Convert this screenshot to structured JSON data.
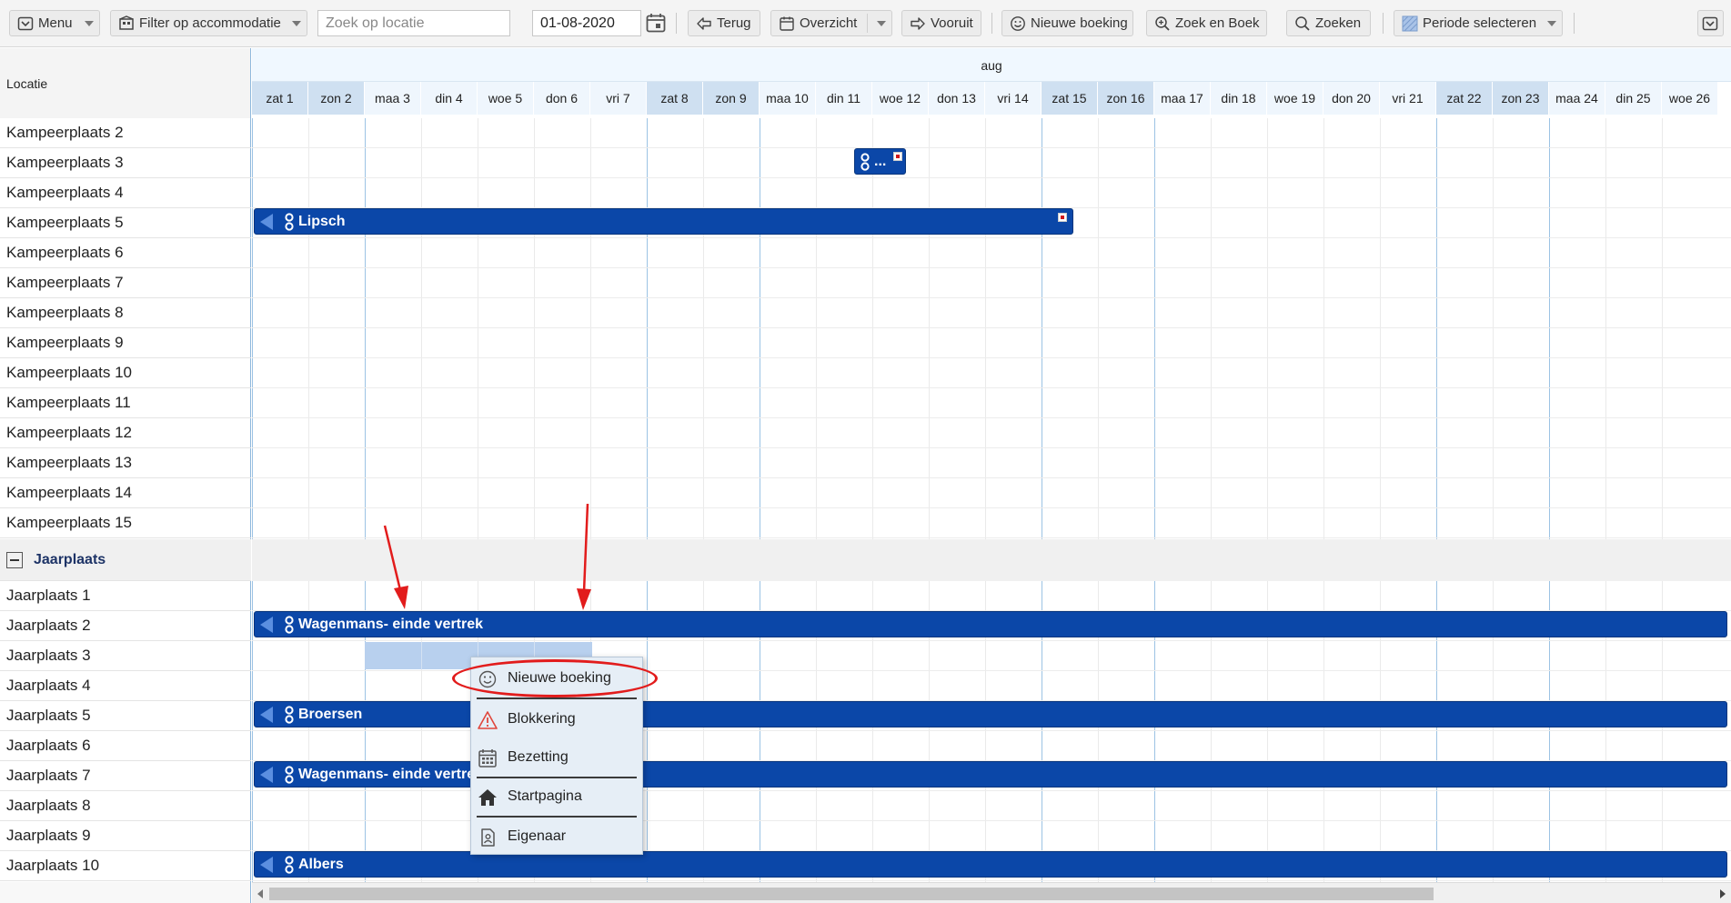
{
  "toolbar": {
    "menu_label": "Menu",
    "filter_label": "Filter op accommodatie",
    "search_placeholder": "Zoek op locatie",
    "date_value": "01-08-2020",
    "back_label": "Terug",
    "overview_label": "Overzicht",
    "forward_label": "Vooruit",
    "new_booking_label": "Nieuwe boeking",
    "search_book_label": "Zoek en Boek",
    "search_label": "Zoeken",
    "period_label": "Periode selecteren"
  },
  "left_header": "Locatie",
  "month": "aug",
  "days": [
    {
      "label": "zat 1",
      "weekend": true
    },
    {
      "label": "zon 2",
      "weekend": true
    },
    {
      "label": "maa 3",
      "weekend": false
    },
    {
      "label": "din 4",
      "weekend": false
    },
    {
      "label": "woe 5",
      "weekend": false
    },
    {
      "label": "don 6",
      "weekend": false
    },
    {
      "label": "vri 7",
      "weekend": false
    },
    {
      "label": "zat 8",
      "weekend": true
    },
    {
      "label": "zon 9",
      "weekend": true
    },
    {
      "label": "maa 10",
      "weekend": false
    },
    {
      "label": "din 11",
      "weekend": false
    },
    {
      "label": "woe 12",
      "weekend": false
    },
    {
      "label": "don 13",
      "weekend": false
    },
    {
      "label": "vri 14",
      "weekend": false
    },
    {
      "label": "zat 15",
      "weekend": true
    },
    {
      "label": "zon 16",
      "weekend": true
    },
    {
      "label": "maa 17",
      "weekend": false
    },
    {
      "label": "din 18",
      "weekend": false
    },
    {
      "label": "woe 19",
      "weekend": false
    },
    {
      "label": "don 20",
      "weekend": false
    },
    {
      "label": "vri 21",
      "weekend": false
    },
    {
      "label": "zat 22",
      "weekend": true
    },
    {
      "label": "zon 23",
      "weekend": true
    },
    {
      "label": "maa 24",
      "weekend": false
    },
    {
      "label": "din 25",
      "weekend": false
    },
    {
      "label": "woe 26",
      "weekend": false
    }
  ],
  "rows": [
    "Kampeerplaats 2",
    "Kampeerplaats 3",
    "Kampeerplaats 4",
    "Kampeerplaats 5",
    "Kampeerplaats 6",
    "Kampeerplaats 7",
    "Kampeerplaats 8",
    "Kampeerplaats 9",
    "Kampeerplaats 10",
    "Kampeerplaats 11",
    "Kampeerplaats 12",
    "Kampeerplaats 13",
    "Kampeerplaats 14",
    "Kampeerplaats 15"
  ],
  "group": {
    "name": "Jaarplaats",
    "rows": [
      "Jaarplaats 1",
      "Jaarplaats 2",
      "Jaarplaats 3",
      "Jaarplaats 4",
      "Jaarplaats 5",
      "Jaarplaats 6",
      "Jaarplaats 7",
      "Jaarplaats 8",
      "Jaarplaats 9",
      "Jaarplaats 10"
    ]
  },
  "bookings": {
    "small_label": "...",
    "lipsch": "Lipsch",
    "wagenmans_1": "Wagenmans- einde vertrek",
    "broersen": "Broersen",
    "wagenmans_2": "Wagenmans- einde vertrek",
    "albers": "Albers"
  },
  "context_menu": {
    "new_booking": "Nieuwe boeking",
    "blocking": "Blokkering",
    "occupancy": "Bezetting",
    "home": "Startpagina",
    "owner": "Eigenaar"
  },
  "colors": {
    "booking_bar": "#0b47a8",
    "weekend_header": "#cfe0f1",
    "selection": "#b8d0ee",
    "annotation_red": "#e21c1c"
  }
}
